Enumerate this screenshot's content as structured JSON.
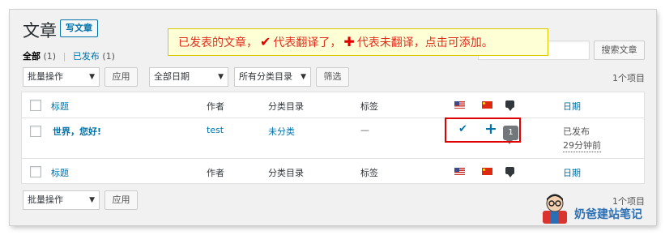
{
  "page": {
    "title": "文章",
    "add_new": "写文章"
  },
  "views": {
    "all_label": "全部",
    "all_count": "(1)",
    "published_label": "已发布",
    "published_count": "(1)"
  },
  "search": {
    "value": "",
    "placeholder": "",
    "button": "搜索文章"
  },
  "callout": {
    "text_1": "已发表的文章，",
    "icon_check": "✔",
    "text_2": "代表翻译了，",
    "icon_plus": "✚",
    "text_3": "代表未翻译，点击可添加。"
  },
  "bulk_actions": {
    "selected": "批量操作",
    "apply": "应用"
  },
  "filters": {
    "date": "全部日期",
    "category": "所有分类目录",
    "filter_button": "筛选"
  },
  "items_count": "1个项目",
  "table": {
    "columns": {
      "title": "标题",
      "author": "作者",
      "categories": "分类目录",
      "tags": "标签",
      "lang_en": "us-flag-icon",
      "lang_zh": "cn-flag-icon",
      "comments": "comment-icon",
      "date": "日期"
    },
    "rows": [
      {
        "title": "世界，您好!",
        "author": "test",
        "category": "未分类",
        "tags": "—",
        "translation_en": "check-icon",
        "translation_zh": "plus-icon",
        "comment_count": "1",
        "status": "已发布",
        "date": "29分钟前"
      }
    ]
  },
  "watermark": {
    "text": "奶爸建站笔记"
  }
}
